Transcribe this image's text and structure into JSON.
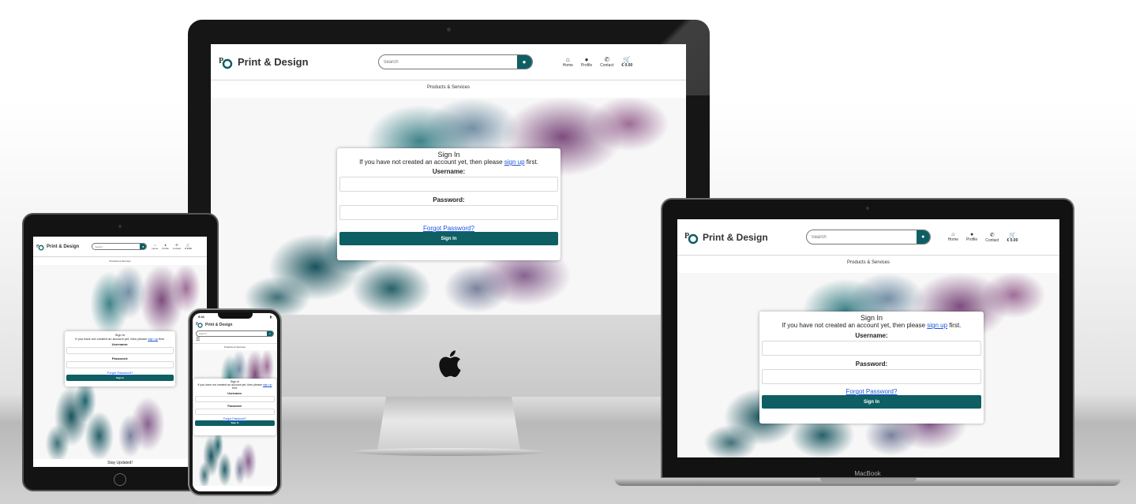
{
  "site": {
    "brand": "Print & Design",
    "search_placeholder": "Search",
    "nav": {
      "home": "Home",
      "profile": "Profile",
      "contact": "Contact",
      "cart": "€ 0.00"
    },
    "subnav": "Products & Services",
    "signin": {
      "title": "Sign In",
      "prompt_before": "If you have not created an account yet, then please ",
      "link": "sign up",
      "prompt_after": " first.",
      "username_label": "Username:",
      "password_label": "Password:",
      "forgot": "Forgot Password?",
      "button": "Sign In"
    },
    "footer_peek": "Stay Updated!"
  },
  "devices": {
    "laptop_label": "MacBook",
    "phone_time": "9:41"
  },
  "colors": {
    "brand_teal": "#0d5f63",
    "link_blue": "#1a55d6"
  },
  "icons": [
    "logo-mark",
    "search-icon",
    "home-icon",
    "profile-icon",
    "phone-icon",
    "cart-icon",
    "apple-logo-icon",
    "hamburger-icon"
  ]
}
